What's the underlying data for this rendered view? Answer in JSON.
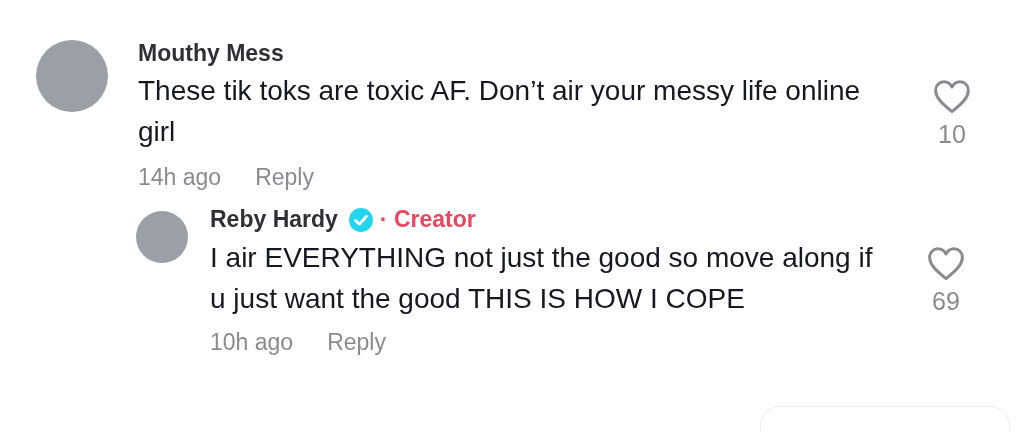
{
  "comments": [
    {
      "author": "Mouthy Mess",
      "verified": false,
      "text": "These tik toks are toxic AF. Don’t air your messy life online girl",
      "time": "14h ago",
      "reply_label": "Reply",
      "liked": false,
      "likes": "10",
      "replies": [
        {
          "author": "Reby Hardy",
          "verified": true,
          "badge": "· Creator",
          "text": "I air EVERYTHING not just the good so move along if u just want the good THIS IS HOW I COPE",
          "time": "10h ago",
          "reply_label": "Reply",
          "liked": false,
          "likes": "69"
        }
      ]
    }
  ]
}
